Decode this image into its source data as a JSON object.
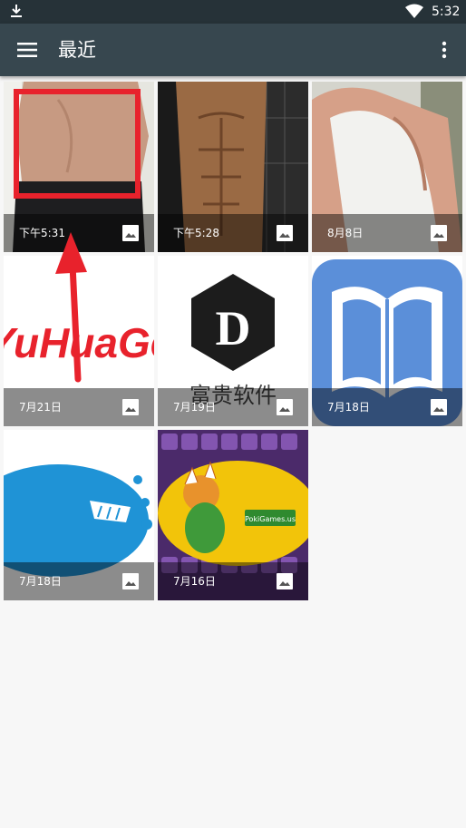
{
  "status_bar": {
    "time": "5:32"
  },
  "app_bar": {
    "title": "最近"
  },
  "tiles": [
    {
      "label": "下午5:31"
    },
    {
      "label": "下午5:28"
    },
    {
      "label": "8月8日"
    },
    {
      "label": "7月21日",
      "image_text": "YuHuaGe"
    },
    {
      "label": "7月19日",
      "image_text": "D",
      "image_caption": "富贵软件"
    },
    {
      "label": "7月18日"
    },
    {
      "label": "7月18日"
    },
    {
      "label": "7月16日",
      "image_text": "PokiGames.us"
    }
  ],
  "colors": {
    "status_bar": "#263238",
    "app_bar": "#37474f",
    "annotation_red": "#e8222c"
  }
}
